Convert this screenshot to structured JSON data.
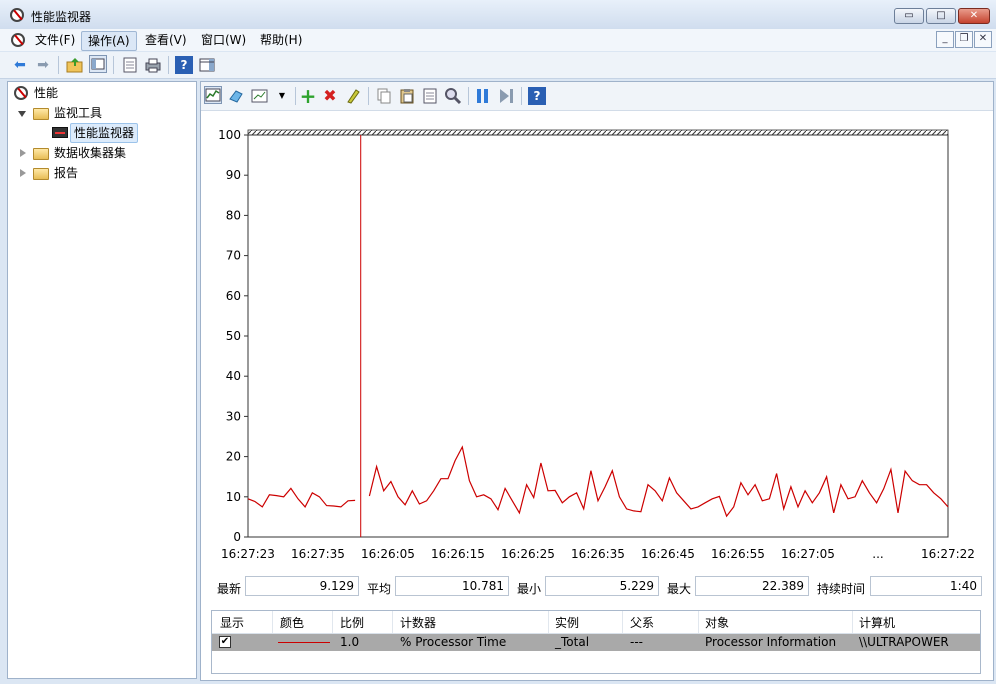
{
  "window": {
    "title": "性能监视器"
  },
  "window_buttons": {
    "minimize": "▭",
    "maximize": "□",
    "close": "✕"
  },
  "mdi_buttons": {
    "minimize": "_",
    "restore": "❐",
    "close": "✕"
  },
  "menu": {
    "items": [
      "文件(F)",
      "操作(A)",
      "查看(V)",
      "窗口(W)",
      "帮助(H)"
    ],
    "active_index": 1
  },
  "toolbar1": {
    "icons": [
      "back-arrow-icon",
      "forward-arrow-icon",
      "up-folder-icon",
      "show-hide-tree-icon",
      "properties-icon",
      "print-icon",
      "help-icon",
      "show-hide-action-pane-icon"
    ]
  },
  "tree": {
    "root": "性能",
    "monitoring_tools": "监视工具",
    "perf_monitor": "性能监视器",
    "data_collector_sets": "数据收集器集",
    "reports": "报告"
  },
  "toolbar2": {
    "icons": [
      "view-graph-icon",
      "freeze-display-icon",
      "change-graph-type-icon",
      "dropdown-icon",
      "add-counter-icon",
      "delete-counter-icon",
      "highlight-icon",
      "copy-properties-icon",
      "paste-counter-list-icon",
      "properties-icon",
      "zoom-icon",
      "pause-icon",
      "update-data-icon",
      "help-icon"
    ]
  },
  "chart_data": {
    "type": "line",
    "ylim": [
      0,
      100
    ],
    "y_ticks": [
      0,
      10,
      20,
      30,
      40,
      50,
      60,
      70,
      80,
      90,
      100
    ],
    "x_tick_labels": [
      "16:27:23",
      "16:27:35",
      "16:26:05",
      "16:26:15",
      "16:26:25",
      "16:26:35",
      "16:26:45",
      "16:26:55",
      "16:27:05",
      "...",
      "16:27:22"
    ],
    "cursor_color": "#cc0000",
    "series": [
      {
        "color": "#cc0000",
        "values": [
          9.5,
          8.8,
          7.5,
          10.5,
          10.3,
          10.0,
          12.1,
          9.5,
          7.5,
          11.0,
          10.0,
          7.8,
          7.7,
          7.5,
          9.0,
          9.1,
          null,
          10.2,
          17.5,
          11.5,
          13.8,
          10.0,
          8.0,
          11.5,
          8.2,
          9.0,
          11.5,
          14.5,
          14.5,
          19.0,
          22.4,
          14.0,
          10.0,
          10.5,
          9.5,
          6.8,
          12.1,
          9.0,
          6.0,
          13.0,
          9.8,
          18.4,
          11.5,
          11.6,
          8.5,
          10.0,
          11.0,
          7.0,
          16.5,
          9.0,
          12.5,
          16.5,
          10.0,
          7.0,
          6.5,
          6.3,
          13.0,
          11.5,
          9.0,
          14.7,
          11.0,
          9.0,
          7.0,
          7.5,
          8.5,
          9.5,
          10.1,
          5.2,
          7.5,
          13.5,
          10.5,
          13.0,
          9.0,
          9.5,
          15.8,
          7.0,
          12.5,
          7.5,
          11.5,
          8.5,
          11.0,
          15.0,
          6.0,
          13.0,
          9.5,
          10.0,
          14.0,
          11.0,
          8.5,
          12.0,
          16.8,
          6.0,
          16.4,
          14.0,
          13.0,
          13.0,
          11.0,
          9.5,
          7.5
        ]
      }
    ]
  },
  "stats": {
    "latest_label": "最新",
    "latest": "9.129",
    "avg_label": "平均",
    "avg": "10.781",
    "min_label": "最小",
    "min": "5.229",
    "max_label": "最大",
    "max": "22.389",
    "duration_label": "持续时间",
    "duration": "1:40"
  },
  "legend": {
    "columns": [
      "显示",
      "颜色",
      "比例",
      "计数器",
      "实例",
      "父系",
      "对象",
      "计算机"
    ],
    "row": {
      "checked": "✔",
      "color": "#cc0000",
      "scale": "1.0",
      "counter": "% Processor Time",
      "instance": "_Total",
      "parent": "---",
      "object": "Processor Information",
      "computer": "\\\\ULTRAPOWER"
    }
  }
}
